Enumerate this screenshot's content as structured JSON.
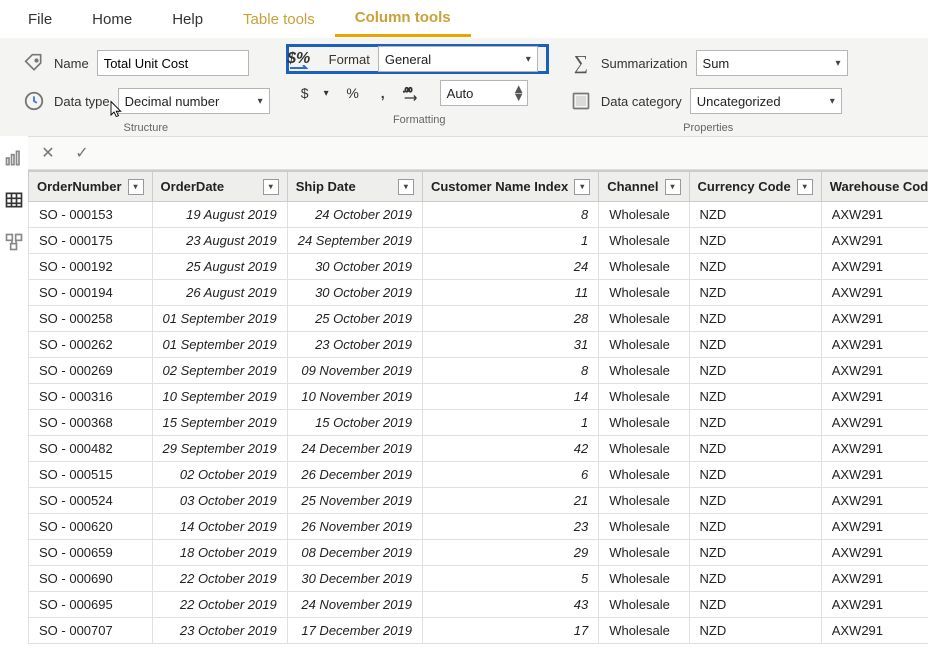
{
  "menu": {
    "file": "File",
    "home": "Home",
    "help": "Help",
    "table_tools": "Table tools",
    "column_tools": "Column tools"
  },
  "ribbon": {
    "structure": {
      "name_label": "Name",
      "name_value": "Total Unit Cost",
      "datatype_label": "Data type",
      "datatype_value": "Decimal number",
      "group_label": "Structure"
    },
    "formatting": {
      "format_label": "Format",
      "format_value": "General",
      "currency_btn": "$",
      "percent_btn": "%",
      "thousands_btn": ",",
      "decimals_value": "Auto",
      "group_label": "Formatting"
    },
    "properties": {
      "summarization_label": "Summarization",
      "summarization_value": "Sum",
      "datacategory_label": "Data category",
      "datacategory_value": "Uncategorized",
      "group_label": "Properties"
    }
  },
  "formula_bar": {
    "value": ""
  },
  "table": {
    "columns": [
      "OrderNumber",
      "OrderDate",
      "Ship Date",
      "Customer Name Index",
      "Channel",
      "Currency Code",
      "Warehouse Code"
    ],
    "rows": [
      {
        "order": "SO - 000153",
        "odate": "19 August 2019",
        "sdate": "24 October 2019",
        "cidx": 8,
        "channel": "Wholesale",
        "curr": "NZD",
        "wh": "AXW291"
      },
      {
        "order": "SO - 000175",
        "odate": "23 August 2019",
        "sdate": "24 September 2019",
        "cidx": 1,
        "channel": "Wholesale",
        "curr": "NZD",
        "wh": "AXW291"
      },
      {
        "order": "SO - 000192",
        "odate": "25 August 2019",
        "sdate": "30 October 2019",
        "cidx": 24,
        "channel": "Wholesale",
        "curr": "NZD",
        "wh": "AXW291"
      },
      {
        "order": "SO - 000194",
        "odate": "26 August 2019",
        "sdate": "30 October 2019",
        "cidx": 11,
        "channel": "Wholesale",
        "curr": "NZD",
        "wh": "AXW291"
      },
      {
        "order": "SO - 000258",
        "odate": "01 September 2019",
        "sdate": "25 October 2019",
        "cidx": 28,
        "channel": "Wholesale",
        "curr": "NZD",
        "wh": "AXW291"
      },
      {
        "order": "SO - 000262",
        "odate": "01 September 2019",
        "sdate": "23 October 2019",
        "cidx": 31,
        "channel": "Wholesale",
        "curr": "NZD",
        "wh": "AXW291"
      },
      {
        "order": "SO - 000269",
        "odate": "02 September 2019",
        "sdate": "09 November 2019",
        "cidx": 8,
        "channel": "Wholesale",
        "curr": "NZD",
        "wh": "AXW291"
      },
      {
        "order": "SO - 000316",
        "odate": "10 September 2019",
        "sdate": "10 November 2019",
        "cidx": 14,
        "channel": "Wholesale",
        "curr": "NZD",
        "wh": "AXW291"
      },
      {
        "order": "SO - 000368",
        "odate": "15 September 2019",
        "sdate": "15 October 2019",
        "cidx": 1,
        "channel": "Wholesale",
        "curr": "NZD",
        "wh": "AXW291"
      },
      {
        "order": "SO - 000482",
        "odate": "29 September 2019",
        "sdate": "24 December 2019",
        "cidx": 42,
        "channel": "Wholesale",
        "curr": "NZD",
        "wh": "AXW291"
      },
      {
        "order": "SO - 000515",
        "odate": "02 October 2019",
        "sdate": "26 December 2019",
        "cidx": 6,
        "channel": "Wholesale",
        "curr": "NZD",
        "wh": "AXW291"
      },
      {
        "order": "SO - 000524",
        "odate": "03 October 2019",
        "sdate": "25 November 2019",
        "cidx": 21,
        "channel": "Wholesale",
        "curr": "NZD",
        "wh": "AXW291"
      },
      {
        "order": "SO - 000620",
        "odate": "14 October 2019",
        "sdate": "26 November 2019",
        "cidx": 23,
        "channel": "Wholesale",
        "curr": "NZD",
        "wh": "AXW291"
      },
      {
        "order": "SO - 000659",
        "odate": "18 October 2019",
        "sdate": "08 December 2019",
        "cidx": 29,
        "channel": "Wholesale",
        "curr": "NZD",
        "wh": "AXW291"
      },
      {
        "order": "SO - 000690",
        "odate": "22 October 2019",
        "sdate": "30 December 2019",
        "cidx": 5,
        "channel": "Wholesale",
        "curr": "NZD",
        "wh": "AXW291"
      },
      {
        "order": "SO - 000695",
        "odate": "22 October 2019",
        "sdate": "24 November 2019",
        "cidx": 43,
        "channel": "Wholesale",
        "curr": "NZD",
        "wh": "AXW291"
      },
      {
        "order": "SO - 000707",
        "odate": "23 October 2019",
        "sdate": "17 December 2019",
        "cidx": 17,
        "channel": "Wholesale",
        "curr": "NZD",
        "wh": "AXW291"
      }
    ]
  }
}
